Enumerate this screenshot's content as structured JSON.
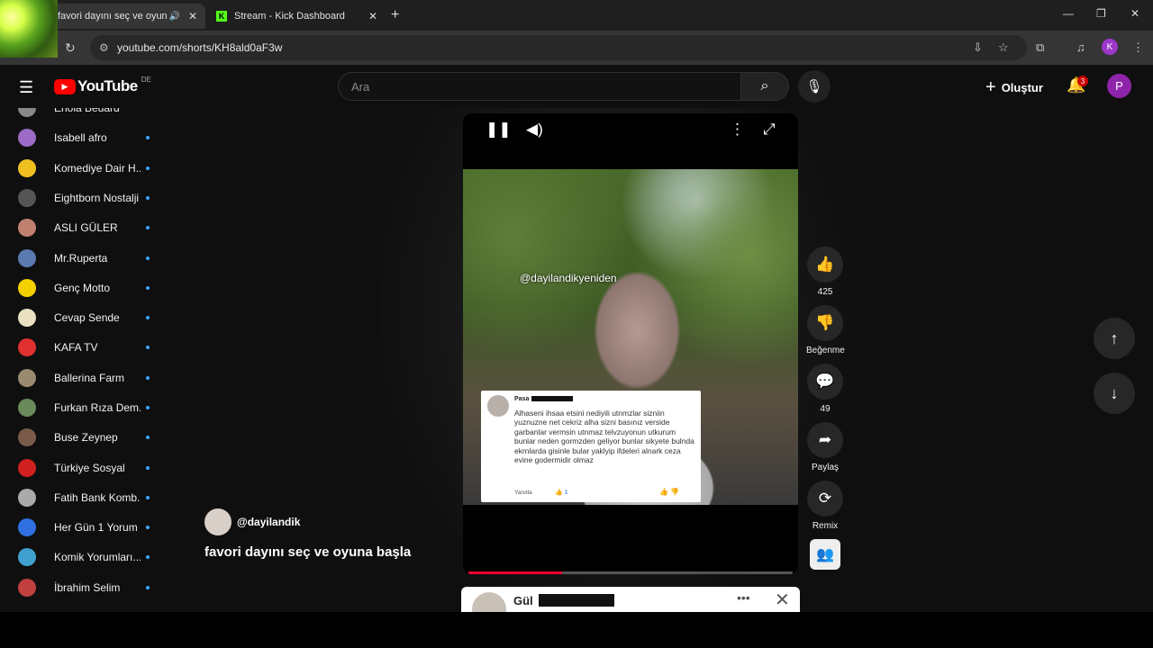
{
  "browser": {
    "tabs": [
      {
        "title": "favori dayını seç ve oyun",
        "active": true
      },
      {
        "title": "Stream - Kick Dashboard",
        "active": false
      }
    ],
    "url": "youtube.com/shorts/KH8ald0aF3w",
    "profile_initial": "K"
  },
  "header": {
    "logo_text": "YouTube",
    "country_code": "DE",
    "search_placeholder": "Ara",
    "create_label": "Oluştur",
    "notification_count": "3",
    "avatar_initial": "P"
  },
  "sidebar": {
    "items": [
      {
        "label": "Enola Bedard",
        "color": "#888"
      },
      {
        "label": "Isabell afro",
        "color": "#9b6bc5"
      },
      {
        "label": "Komediye Dair H...",
        "color": "#f0c020"
      },
      {
        "label": "Eightborn Nostalji",
        "color": "#555"
      },
      {
        "label": "ASLI GÜLER",
        "color": "#c08070"
      },
      {
        "label": "Mr.Ruperta",
        "color": "#5a7ab0"
      },
      {
        "label": "Genç Motto",
        "color": "#f5d000"
      },
      {
        "label": "Cevap Sende",
        "color": "#e8e0c0"
      },
      {
        "label": "KAFA TV",
        "color": "#e03030"
      },
      {
        "label": "Ballerina Farm",
        "color": "#9a8a70"
      },
      {
        "label": "Furkan Rıza Dem...",
        "color": "#6a8a5a"
      },
      {
        "label": "Buse Zeynep",
        "color": "#7a5a4a"
      },
      {
        "label": "Türkiye Sosyal",
        "color": "#d02020"
      },
      {
        "label": "Fatih Bank Komb...",
        "color": "#aaa"
      },
      {
        "label": "Her Gün 1 Yorum",
        "color": "#3070e0"
      },
      {
        "label": "Komik Yorumları...",
        "color": "#40a0d0"
      },
      {
        "label": "İbrahim Selim",
        "color": "#c04040"
      }
    ]
  },
  "video": {
    "watermark": "@dayilandikyeniden",
    "comment": {
      "name": "Pasa",
      "text": "Alhaseni ihsaa etsini nediyili utnmzlar sizniin yuznuzne net cekriz alha sizni basınız verside garbanlar vermsin utnmaz  telvzuyonun utkurum bunlar neden gormzden geliyor bunlar sikyete bulnda ekrnlarda gisinle bular yaklyip ifdeleri alnark ceza evine godermidir olmaz",
      "reply": "Yanıtla",
      "likes": "1"
    },
    "progress": 0.29,
    "channel": "@dayilandik",
    "title": "favori dayını seç ve oyuna başla"
  },
  "actions": {
    "like_count": "425",
    "dislike_label": "Beğenme",
    "comment_count": "49",
    "share_label": "Paylaş",
    "remix_label": "Remix"
  },
  "next_card": {
    "name": "Gül"
  }
}
